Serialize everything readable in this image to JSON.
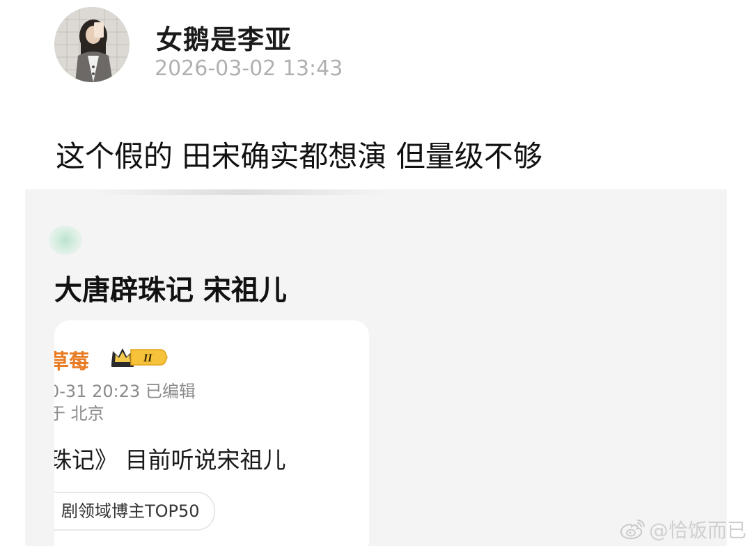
{
  "post": {
    "username": "女鹅是李亚",
    "timestamp": "2026-03-02 13:43",
    "text": "这个假的 田宋确实都想演 但量级不够"
  },
  "embedded": {
    "title": "大唐辟珠记  宋祖儿",
    "card": {
      "author": "草莓",
      "badge_level": "II",
      "meta": "0-31 20:23   已编辑",
      "location": "于 北京",
      "body": "珠记》 目前听说宋祖儿",
      "tag": "剧领域博主TOP50"
    }
  },
  "watermark": {
    "text": "@恰饭而已",
    "icon": "weibo-icon"
  },
  "colors": {
    "author_orange": "#e97b22",
    "timestamp_gray": "#b0b0b0",
    "embed_bg": "#f4f4f4"
  }
}
